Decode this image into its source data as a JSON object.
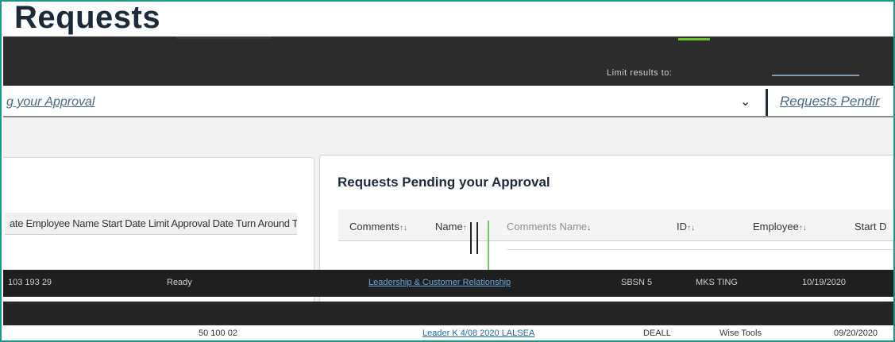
{
  "page": {
    "title": "Requests"
  },
  "toolbar": {
    "limit_label": "Limit results to:"
  },
  "filter": {
    "left_value": "g your Approval",
    "right_value": "Requests Pendir"
  },
  "left_table": {
    "header": "ate Employee Name Start Date Limit Approval Date Turn Around Time Comments Status"
  },
  "right_panel": {
    "title": "Requests Pending your Approval",
    "columns": [
      {
        "label": "Comments",
        "sort": "↑↓"
      },
      {
        "label": "Name",
        "sort": "↑"
      },
      {
        "label": "Comments Name",
        "sort": "↓"
      },
      {
        "label": "ID",
        "sort": "↑↓"
      },
      {
        "label": "Employee",
        "sort": "↑↓"
      },
      {
        "label": "Start D",
        "sort": ""
      }
    ]
  },
  "rows": [
    {
      "left_id": "103 193 29",
      "left_status": "Ready",
      "right_link": "Leadership & Customer Relationship",
      "right_id": "SBSN 5",
      "right_name": "MKS TING",
      "right_date": "10/19/2020"
    },
    {
      "left_id": "50 100 02",
      "left_status": "",
      "right_link": "Leader K 4/08 2020 LALSEA",
      "right_id": "DEALL",
      "right_name": "Wise Tools",
      "right_date": "09/20/2020"
    }
  ],
  "colors": {
    "frame": "#1a9a86",
    "dark_band": "#2c2c2c",
    "accent_green": "#6fbf2f",
    "link": "#4a6a86",
    "sort_red": "#d0271d",
    "sort_green": "#2b8a2b"
  }
}
